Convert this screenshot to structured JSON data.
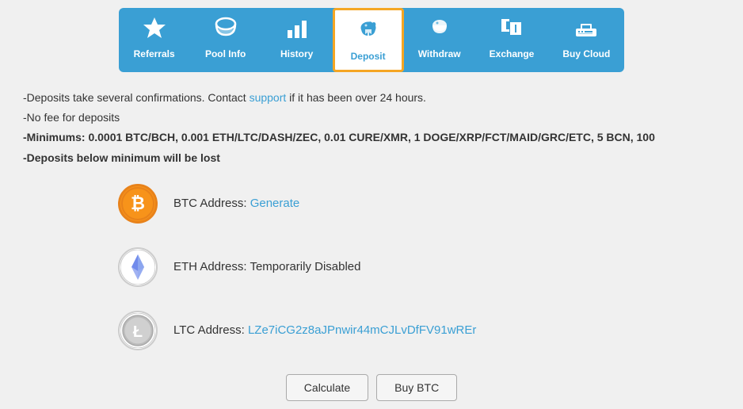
{
  "nav": {
    "items": [
      {
        "id": "referrals",
        "label": "Referrals",
        "icon": "⭐",
        "active": false
      },
      {
        "id": "pool-info",
        "label": "Pool Info",
        "icon": "☁",
        "active": false
      },
      {
        "id": "history",
        "label": "History",
        "icon": "📊",
        "active": false
      },
      {
        "id": "deposit",
        "label": "Deposit",
        "icon": "🐷",
        "active": true
      },
      {
        "id": "withdraw",
        "label": "Withdraw",
        "icon": "🐷",
        "active": false
      },
      {
        "id": "exchange",
        "label": "Exchange",
        "icon": "💹",
        "active": false
      },
      {
        "id": "buy-cloud",
        "label": "Buy Cloud",
        "icon": "💻",
        "active": false
      }
    ]
  },
  "info": {
    "line1_pre": "-Deposits take several confirmations. Contact ",
    "line1_link": "support",
    "line1_post": " if it has been over 24 hours.",
    "line2": "-No fee for deposits",
    "line3": "-Minimums: 0.0001 BTC/BCH, 0.001 ETH/LTC/DASH/ZEC, 0.01 CURE/XMR, 1 DOGE/XRP/FCT/MAID/GRC/ETC, 5 BCN, 100",
    "line4": "-Deposits below minimum will be lost"
  },
  "coins": [
    {
      "id": "btc",
      "label": "BTC Address: ",
      "value": "Generate",
      "value_type": "link",
      "has_address": false
    },
    {
      "id": "eth",
      "label": "ETH Address: ",
      "value": "Temporarily Disabled",
      "value_type": "text",
      "has_address": false
    },
    {
      "id": "ltc",
      "label": "LTC Address: ",
      "value": "LZe7iCG2z8aJPnwir44mCJLvDfFV91wREr",
      "value_type": "link",
      "has_address": true
    }
  ],
  "buttons": {
    "calculate": "Calculate",
    "buy_btc": "Buy BTC"
  }
}
